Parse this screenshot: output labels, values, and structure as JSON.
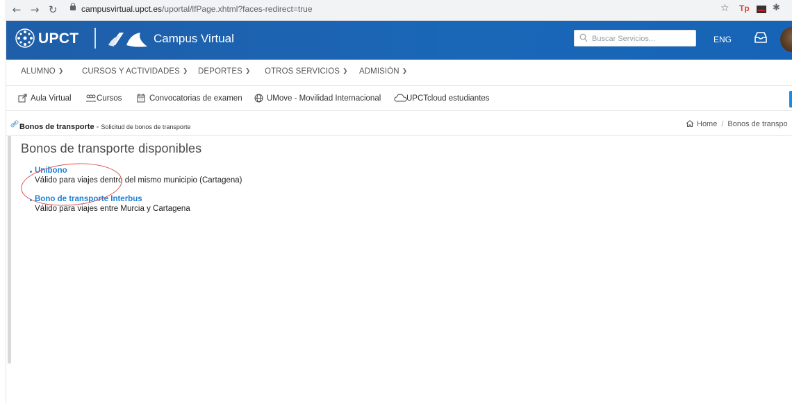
{
  "browser": {
    "url_domain": "campusvirtual.upct.es",
    "url_path": "/uportal/lfPage.xhtml?faces-redirect=true",
    "extension_tp": "Tp"
  },
  "header": {
    "brand": "UPCT",
    "app_name": "Campus Virtual",
    "search_placeholder": "Buscar Servicios...",
    "lang": "ENG",
    "accent_color": "#1a67b8"
  },
  "main_nav": [
    {
      "label": "ALUMNO"
    },
    {
      "label": "CURSOS Y ACTIVIDADES"
    },
    {
      "label": "DEPORTES"
    },
    {
      "label": "OTROS SERVICIOS"
    },
    {
      "label": "ADMISIÓN"
    }
  ],
  "shortcuts": [
    {
      "label": "Aula Virtual",
      "icon": "external-link-icon"
    },
    {
      "label": "Cursos",
      "icon": "users-icon"
    },
    {
      "label": "Convocatorias de examen",
      "icon": "calendar-icon"
    },
    {
      "label": "UMove - Movilidad Internacional",
      "icon": "globe-icon"
    },
    {
      "label": "UPCTcloud estudiantes",
      "icon": "cloud-icon"
    }
  ],
  "breadcrumb": {
    "title": "Bonos de transporte",
    "dash": " - ",
    "subtitle": "Solicitud de bonos de transporte",
    "home": "Home",
    "current": "Bonos de transpo"
  },
  "content": {
    "title": "Bonos de transporte disponibles",
    "bonos": [
      {
        "name": "Unibono",
        "description": "Válido para viajes dentro del mismo municipio (Cartagena)"
      },
      {
        "name": "Bono de transporte Interbus",
        "description": "Válido para viajes entre Murcia y Cartagena"
      }
    ]
  }
}
